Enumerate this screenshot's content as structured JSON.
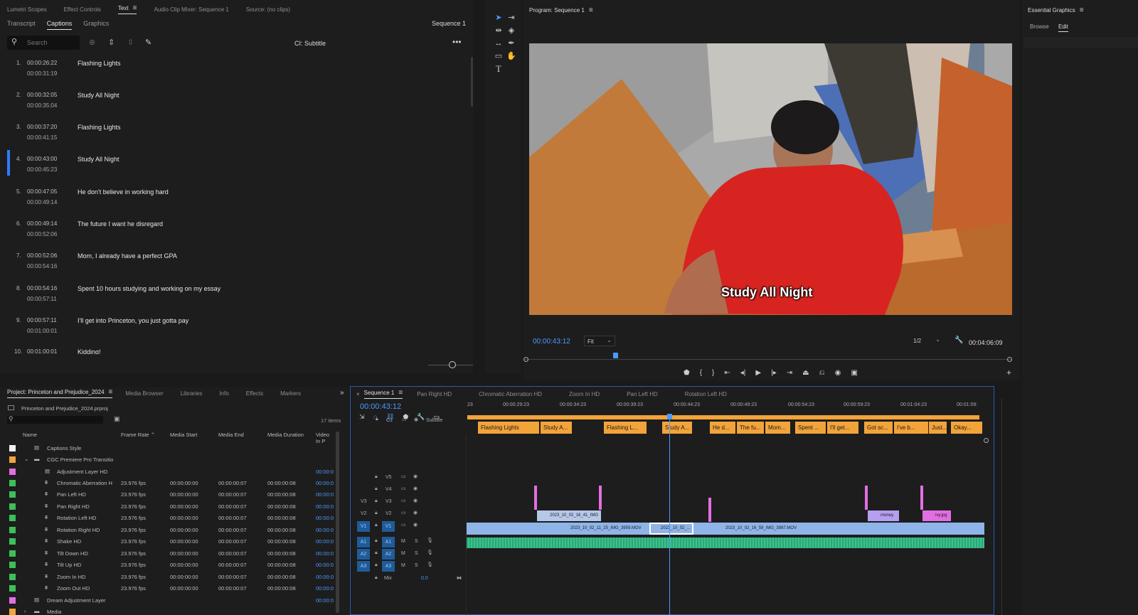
{
  "top_tabs": [
    "Lumetri Scopes",
    "Effect Controls",
    "Text",
    "Audio Clip Mixer: Sequence 1",
    "Source: (no clips)"
  ],
  "text_panel": {
    "subtabs": [
      "Transcript",
      "Captions",
      "Graphics"
    ],
    "sequence": "Sequence 1",
    "search_placeholder": "Search",
    "track_label": "CI: Subtitle",
    "captions": [
      {
        "num": "1.",
        "in": "00:00:26:22",
        "out": "00:00:31:19",
        "text": "Flashing Lights"
      },
      {
        "num": "2.",
        "in": "00:00:32:05",
        "out": "00:00:35:04",
        "text": "Study All Night"
      },
      {
        "num": "3.",
        "in": "00:00:37:20",
        "out": "00:00:41:15",
        "text": "Flashing Lights"
      },
      {
        "num": "4.",
        "in": "00:00:43:00",
        "out": "00:00:45:23",
        "text": "Study All Night"
      },
      {
        "num": "5.",
        "in": "00:00:47:05",
        "out": "00:00:49:14",
        "text": "He don't believe in working hard"
      },
      {
        "num": "6.",
        "in": "00:00:49:14",
        "out": "00:00:52:06",
        "text": "The future I want he disregard"
      },
      {
        "num": "7.",
        "in": "00:00:52:06",
        "out": "00:00:54:16",
        "text": "Mom, I already have a perfect GPA"
      },
      {
        "num": "8.",
        "in": "00:00:54:16",
        "out": "00:00:57:11",
        "text": "Spent 10 hours studying and working on my essay"
      },
      {
        "num": "9.",
        "in": "00:00:57:11",
        "out": "00:01:00:01",
        "text": "I'll get into Princeton, you just gotta pay"
      },
      {
        "num": "10.",
        "in": "00:01:00:01",
        "out": "",
        "text": "Kidding!"
      }
    ]
  },
  "program": {
    "title": "Program: Sequence 1",
    "timecode": "00:00:43:12",
    "fit": "Fit",
    "resolution": "1/2",
    "duration": "00:04:06:09",
    "subtitle_overlay": "Study All Night"
  },
  "essential_graphics": {
    "title": "Essential Graphics",
    "tabs": [
      "Browse",
      "Edit"
    ]
  },
  "project": {
    "tabs": [
      "Project: Princeton and Prejudice_2024",
      "Media Browser",
      "Libraries",
      "Info",
      "Effects",
      "Markers"
    ],
    "file": "Princeton and Prejudice_2024.prproj",
    "items_count": "17 items",
    "columns": [
      "Name",
      "Frame Rate",
      "Media Start",
      "Media End",
      "Media Duration",
      "Video In P"
    ],
    "rows": [
      {
        "name": "Captions Style",
        "color": "#f2f2f2",
        "fps": "",
        "start": "",
        "end": "",
        "dur": "",
        "vin": "",
        "indent": 1,
        "kind": "doc"
      },
      {
        "name": "CGC Premiere Pro Transitio",
        "color": "#f2a33a",
        "fps": "",
        "start": "",
        "end": "",
        "dur": "",
        "vin": "",
        "indent": 1,
        "kind": "folder"
      },
      {
        "name": "Adjustment Layer HD",
        "color": "#e36ee3",
        "fps": "",
        "start": "",
        "end": "",
        "dur": "",
        "vin": "00:00:0",
        "indent": 2,
        "kind": "doc"
      },
      {
        "name": "Chromatic Aberration H",
        "color": "#3dbf5a",
        "fps": "23.976 fps",
        "start": "00:00:00:00",
        "end": "00:00:00:07",
        "dur": "00:00:00:08",
        "vin": "00:00:0",
        "indent": 2,
        "kind": "seq"
      },
      {
        "name": "Pan Left HD",
        "color": "#3dbf5a",
        "fps": "23.976 fps",
        "start": "00:00:00:00",
        "end": "00:00:00:07",
        "dur": "00:00:00:08",
        "vin": "00:00:0",
        "indent": 2,
        "kind": "seq"
      },
      {
        "name": "Pan Right HD",
        "color": "#3dbf5a",
        "fps": "23.976 fps",
        "start": "00:00:00:00",
        "end": "00:00:00:07",
        "dur": "00:00:00:08",
        "vin": "00:00:0",
        "indent": 2,
        "kind": "seq"
      },
      {
        "name": "Rotation Left HD",
        "color": "#3dbf5a",
        "fps": "23.976 fps",
        "start": "00:00:00:00",
        "end": "00:00:00:07",
        "dur": "00:00:00:08",
        "vin": "00:00:0",
        "indent": 2,
        "kind": "seq"
      },
      {
        "name": "Rotation Right HD",
        "color": "#3dbf5a",
        "fps": "23.976 fps",
        "start": "00:00:00:00",
        "end": "00:00:00:07",
        "dur": "00:00:00:08",
        "vin": "00:00:0",
        "indent": 2,
        "kind": "seq"
      },
      {
        "name": "Shake HD",
        "color": "#3dbf5a",
        "fps": "23.976 fps",
        "start": "00:00:00:00",
        "end": "00:00:00:07",
        "dur": "00:00:00:08",
        "vin": "00:00:0",
        "indent": 2,
        "kind": "seq"
      },
      {
        "name": "Tilt Down HD",
        "color": "#3dbf5a",
        "fps": "23.976 fps",
        "start": "00:00:00:00",
        "end": "00:00:00:07",
        "dur": "00:00:00:08",
        "vin": "00:00:0",
        "indent": 2,
        "kind": "seq"
      },
      {
        "name": "Tilt Up HD",
        "color": "#3dbf5a",
        "fps": "23.976 fps",
        "start": "00:00:00:00",
        "end": "00:00:00:07",
        "dur": "00:00:00:08",
        "vin": "00:00:0",
        "indent": 2,
        "kind": "seq"
      },
      {
        "name": "Zoom In HD",
        "color": "#3dbf5a",
        "fps": "23.976 fps",
        "start": "00:00:00:00",
        "end": "00:00:00:07",
        "dur": "00:00:00:08",
        "vin": "00:00:0",
        "indent": 2,
        "kind": "seq"
      },
      {
        "name": "Zoom Out HD",
        "color": "#3dbf5a",
        "fps": "23.976 fps",
        "start": "00:00:00:00",
        "end": "00:00:00:07",
        "dur": "00:00:00:08",
        "vin": "00:00:0",
        "indent": 2,
        "kind": "seq"
      },
      {
        "name": "Dream Adjustment Layer",
        "color": "#e36ee3",
        "fps": "",
        "start": "",
        "end": "",
        "dur": "",
        "vin": "00:00:0",
        "indent": 1,
        "kind": "doc"
      },
      {
        "name": "Media",
        "color": "#f2a33a",
        "fps": "",
        "start": "",
        "end": "",
        "dur": "",
        "vin": "",
        "indent": 1,
        "kind": "folder"
      }
    ]
  },
  "timeline": {
    "tabs": [
      "Sequence 1",
      "Pan Right HD",
      "Chromatic Aberration HD",
      "Zoom In HD",
      "Pan Left HD",
      "Rotation Left HD"
    ],
    "timecode": "00:00:43:12",
    "ruler": [
      "23",
      "00:00:29:23",
      "00:00:34:23",
      "00:00:39:23",
      "00:00:44:23",
      "00:00:49:23",
      "00:00:54:23",
      "00:00:59:23",
      "00:01:04:23",
      "00:01:09:"
    ],
    "caption_track": "Subtitle",
    "caption_track_id": "C1",
    "caption_clips": [
      "Flashing Lights",
      "Study A...",
      "Flashing L...",
      "Study A...",
      "He d...",
      "The fu...",
      "Mom...",
      "Spent ...",
      "I'll get...",
      "Got sc...",
      "I've b...",
      "Just...",
      "Okay..."
    ],
    "video_tracks": [
      "V5",
      "V4",
      "V3",
      "V2",
      "V1"
    ],
    "audio_tracks": [
      "A1",
      "A2",
      "A3"
    ],
    "mix_label": "Mix",
    "mix_value": "0.0",
    "clips": {
      "v2a": "2023_10_02_16_41_IMG",
      "v1a": "2023_10_02_11_25_IMG_3959.MOV",
      "v1b": "2023_10_02_...",
      "v1c": "2023_10_02_16_59_IMG_3987.MOV",
      "v2b": "money.",
      "v2c": "ivy.jpg"
    }
  },
  "colors": {
    "accent": "#4a9bff",
    "caption_clip": "#f2a33a",
    "video_clip": "#8fb4e8",
    "audio_clip": "#3fbf8c",
    "adjustment": "#e36ee3"
  }
}
